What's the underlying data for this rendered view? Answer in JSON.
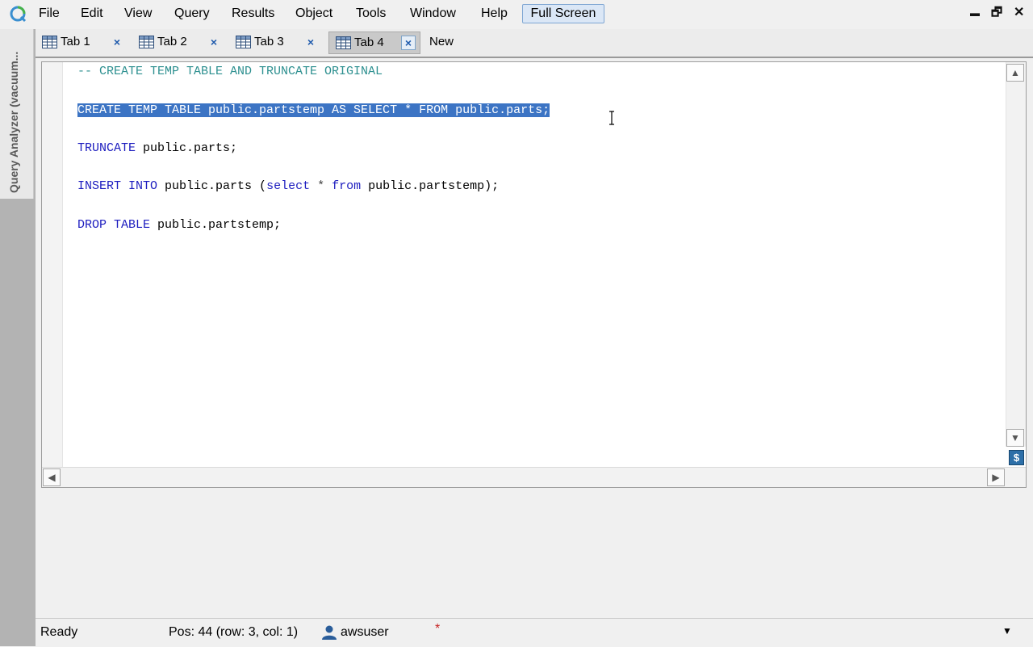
{
  "menu": {
    "items": [
      "File",
      "Edit",
      "View",
      "Query",
      "Results",
      "Object",
      "Tools",
      "Window",
      "Help"
    ],
    "fullscreen_label": "Full Screen"
  },
  "window_controls": {
    "minimize": "▬",
    "restore": "🗗",
    "close": "✕"
  },
  "sidebar": {
    "panel_label": "Query Analyzer (vacuum..."
  },
  "tabs": {
    "items": [
      {
        "label": "Tab 1",
        "close": "×"
      },
      {
        "label": "Tab 2",
        "close": "×"
      },
      {
        "label": "Tab 3",
        "close": "×"
      },
      {
        "label": "Tab 4",
        "close": "×",
        "active": true
      }
    ],
    "new_label": "New"
  },
  "editor": {
    "lines": [
      {
        "parts": [
          {
            "t": "-- CREATE TEMP TABLE AND TRUNCATE ORIGINAL",
            "c": "comment"
          }
        ]
      },
      {
        "selected": true,
        "parts": [
          {
            "t": "CREATE TEMP TABLE public.partstemp AS SELECT * FROM public.parts;",
            "c": "sel"
          }
        ]
      },
      {
        "parts": [
          {
            "t": "TRUNCATE",
            "c": "kw"
          },
          {
            "t": " public.parts;",
            "c": "text"
          }
        ]
      },
      {
        "parts": [
          {
            "t": "INSERT INTO",
            "c": "kw"
          },
          {
            "t": " public.parts (",
            "c": "text"
          },
          {
            "t": "select",
            "c": "kw"
          },
          {
            "t": " * ",
            "c": "sym"
          },
          {
            "t": "from",
            "c": "kw"
          },
          {
            "t": " public.partstemp);",
            "c": "text"
          }
        ]
      },
      {
        "parts": [
          {
            "t": "DROP TABLE",
            "c": "kw"
          },
          {
            "t": " public.partstemp;",
            "c": "text"
          }
        ]
      }
    ],
    "scroll_up": "▲",
    "scroll_down": "▼",
    "scroll_left": "◀",
    "scroll_right": "▶",
    "dollar_label": "$"
  },
  "status": {
    "state": "Ready",
    "position": "Pos: 44 (row: 3, col: 1)",
    "user": "awsuser",
    "modified": "*",
    "dropdown": "▼"
  },
  "colors": {
    "comment": "#2e9090",
    "keyword": "#1d1dbf",
    "selection": "#3c74c4",
    "sidebar": "#b3b3b3"
  }
}
